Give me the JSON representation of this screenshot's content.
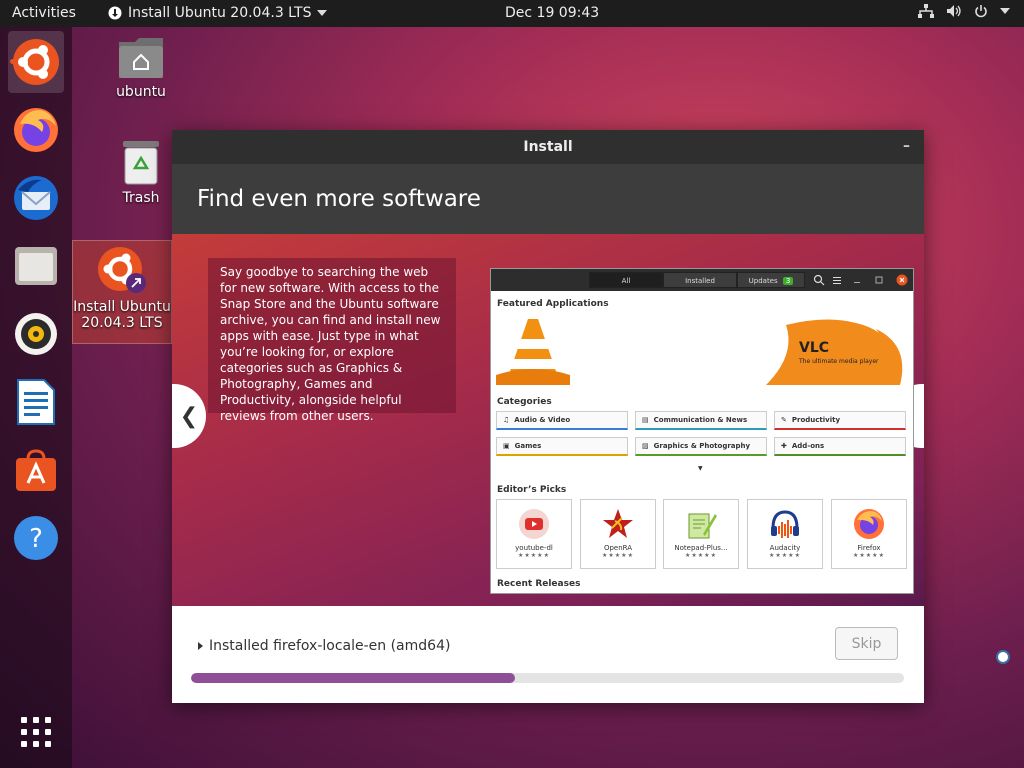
{
  "topbar": {
    "activities": "Activities",
    "app_menu": "Install Ubuntu 20.04.3 LTS",
    "clock": "Dec 19  09:43"
  },
  "dock": {
    "items": [
      "ubuntu-installer",
      "firefox",
      "thunderbird",
      "files",
      "rhythmbox",
      "libreoffice-writer",
      "ubuntu-software",
      "help",
      "show-applications"
    ]
  },
  "desktop": {
    "home_label": "ubuntu",
    "trash_label": "Trash",
    "installer_label_line1": "Install Ubuntu",
    "installer_label_line2": "20.04.3 LTS"
  },
  "window": {
    "title": "Install",
    "minimize": "–",
    "slide_title": "Find even more software",
    "slide_text": "Say goodbye to searching the web for new software. With access to the Snap Store and the Ubuntu software archive, you can find and install new apps with ease. Just type in what you’re looking for, or explore categories such as Graphics & Photography, Games and Productivity, alongside helpful reviews from other users.",
    "prev_arrow": "❮",
    "next_arrow": "❯",
    "status": "Installed firefox-locale-en (amd64)",
    "skip": "Skip",
    "progress": 0.455
  },
  "software_preview": {
    "tabs": [
      "All",
      "Installed",
      "Updates"
    ],
    "updates_count": "3",
    "featured_title": "Featured Applications",
    "featured_app": "VLC",
    "featured_tagline": "The ultimate media player",
    "categories_title": "Categories",
    "categories": [
      "Audio & Video",
      "Communication & News",
      "Productivity",
      "Games",
      "Graphics & Photography",
      "Add-ons"
    ],
    "editors_title": "Editor’s Picks",
    "picks": [
      "youtube-dl",
      "OpenRA",
      "Notepad-Plus...",
      "Audacity",
      "Firefox"
    ],
    "stars": "★★★★★",
    "recent_title": "Recent Releases"
  },
  "colors": {
    "accent": "#e95420",
    "progress": "#8f4f96"
  }
}
